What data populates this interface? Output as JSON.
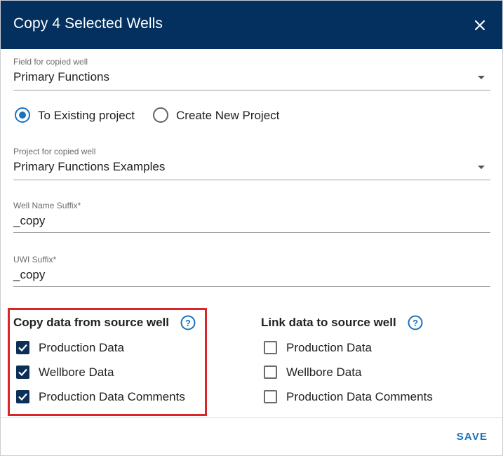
{
  "dialog": {
    "title": "Copy 4 Selected Wells",
    "close_icon": "close-icon"
  },
  "field_for_copied_well": {
    "label": "Field for copied well",
    "value": "Primary Functions"
  },
  "target": {
    "options": [
      {
        "label": "To Existing project",
        "selected": true
      },
      {
        "label": "Create New Project",
        "selected": false
      }
    ]
  },
  "project_for_copied_well": {
    "label": "Project for copied well",
    "value": "Primary Functions Examples"
  },
  "well_name_suffix": {
    "label": "Well Name Suffix*",
    "value": "_copy"
  },
  "uwi_suffix": {
    "label": "UWI Suffix*",
    "value": "_copy"
  },
  "copy_data": {
    "title": "Copy data from source well",
    "help_icon": "help-circle-icon",
    "items": [
      {
        "label": "Production Data",
        "checked": true
      },
      {
        "label": "Wellbore Data",
        "checked": true
      },
      {
        "label": "Production Data Comments",
        "checked": true
      }
    ]
  },
  "link_data": {
    "title": "Link data to source well",
    "help_icon": "help-circle-icon",
    "items": [
      {
        "label": "Production Data",
        "checked": false
      },
      {
        "label": "Wellbore Data",
        "checked": false
      },
      {
        "label": "Production Data Comments",
        "checked": false
      }
    ]
  },
  "footer": {
    "save_label": "SAVE"
  },
  "colors": {
    "header": "#03305f",
    "accent": "#1773c2",
    "checkbox_checked": "#0b2f56",
    "highlight": "#d9262b"
  }
}
